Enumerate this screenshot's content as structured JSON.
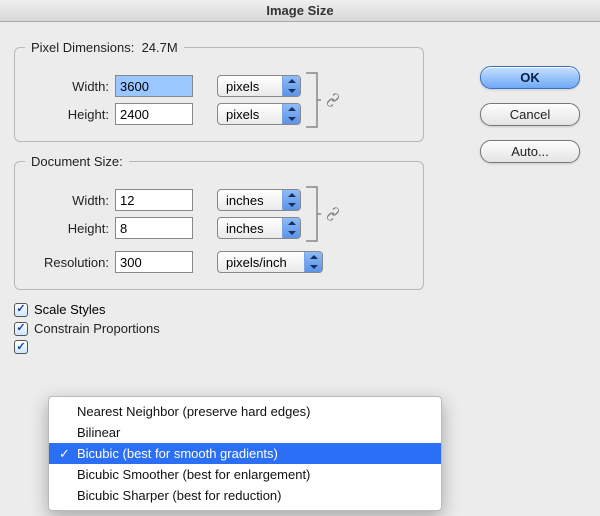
{
  "title": "Image Size",
  "buttons": {
    "ok": "OK",
    "cancel": "Cancel",
    "auto": "Auto..."
  },
  "pixel_dimensions": {
    "legend": "Pixel Dimensions:",
    "size": "24.7M",
    "width_label": "Width:",
    "width_value": "3600",
    "width_unit": "pixels",
    "height_label": "Height:",
    "height_value": "2400",
    "height_unit": "pixels"
  },
  "document_size": {
    "legend": "Document Size:",
    "width_label": "Width:",
    "width_value": "12",
    "width_unit": "inches",
    "height_label": "Height:",
    "height_value": "8",
    "height_unit": "inches",
    "resolution_label": "Resolution:",
    "resolution_value": "300",
    "resolution_unit": "pixels/inch"
  },
  "checkboxes": {
    "scale_styles": "Scale Styles",
    "constrain_truncated": "Constrain Proportions"
  },
  "menu": {
    "items": [
      "Nearest Neighbor (preserve hard edges)",
      "Bilinear",
      "Bicubic (best for smooth gradients)",
      "Bicubic Smoother (best for enlargement)",
      "Bicubic Sharper (best for reduction)"
    ],
    "selected_index": 2
  }
}
